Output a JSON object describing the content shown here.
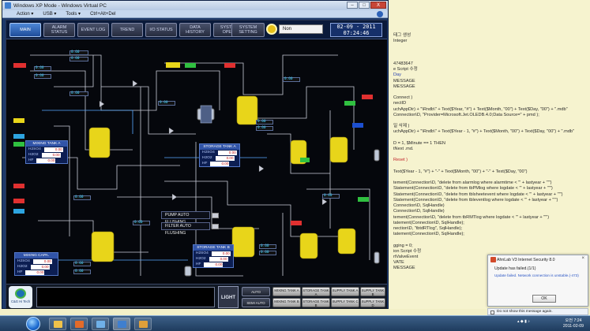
{
  "vm_window": {
    "title": "Windows XP Mode - Windows Virtual PC",
    "menu": [
      "Action ▾",
      "USB ▾",
      "Tools ▾",
      "Ctrl+Alt+Del"
    ],
    "controls": [
      "–",
      "□",
      "X"
    ]
  },
  "hmi": {
    "nav": [
      "MAIN",
      "ALARM STATUS",
      "EVENT LOG",
      "TREND",
      "I/O STATUS",
      "DATA HISTORY",
      "SYSTEM OPER.",
      "SYSTEM SETTING"
    ],
    "active_nav": "MAIN",
    "status_text": "Non",
    "date": "02-09 - 2011",
    "time": "07:24:46",
    "tank_labels": {
      "mixing_a": "MIXING TANK A",
      "mixing_capa": "MIXING CAPA.",
      "storage_a": "STORAGE TANK A",
      "storage_b": "STORAGE TANK B"
    },
    "tank_rows": {
      "mixing_a": [
        {
          "k": "H2SO4",
          "v": "0.00"
        },
        {
          "k": "H2O2",
          "v": "0.00"
        },
        {
          "k": "HF",
          "v": "0.00"
        }
      ],
      "mixing_capa": [
        {
          "k": "H2SO4",
          "v": "0.00"
        },
        {
          "k": "H2O2",
          "v": "0.00"
        },
        {
          "k": "HF",
          "v": "0.00"
        }
      ],
      "storage_a": [
        {
          "k": "H2SO4",
          "v": "0.00"
        },
        {
          "k": "H2O2",
          "v": "0.00"
        },
        {
          "k": "HF",
          "v": "0.00"
        }
      ],
      "storage_b": [
        {
          "k": "H2SO4",
          "v": "0.00"
        },
        {
          "k": "H2O2",
          "v": "0.00"
        },
        {
          "k": "HF",
          "v": "0.00"
        }
      ]
    },
    "flush": [
      "PUMP AUTO FLUSHING",
      "FILTER AUTO FLUSHING"
    ],
    "bottom": {
      "light": "LIGHT",
      "auto": "AUTO",
      "semi_auto": "SEMI AUTO",
      "tank_buttons_top": [
        "MIXING TANK A",
        "STORAGE TANK A",
        "SUPPLY TANK A",
        "SUPPLY TANK B"
      ],
      "tank_buttons_bottom": [
        "MIXING TANK B",
        "STORAGE TANK B",
        "SUPPLY TANK C",
        "SUPPLY TANK D"
      ],
      "logo_text": "C&G Hi Tech"
    },
    "flow_tags": [
      "0.00",
      "0.00",
      "0.00",
      "0.00",
      "0.00",
      "0.00",
      "0.00",
      "0.00",
      "0.00",
      "0.00",
      "0.00",
      "0.00",
      "0.00",
      "0.00",
      "0.00",
      "0.00"
    ]
  },
  "code_pane": {
    "lines": [
      {
        "t": "태그 생성",
        "c": ""
      },
      {
        "t": "Integer",
        "c": ""
      },
      {
        "t": "",
        "c": ""
      },
      {
        "t": "",
        "c": ""
      },
      {
        "t": "",
        "c": ""
      },
      {
        "t": "47483647",
        "c": ""
      },
      {
        "t": "e Script 수정",
        "c": ""
      },
      {
        "t": "Day",
        "c": "b"
      },
      {
        "t": "MESSAGE",
        "c": ""
      },
      {
        "t": "MESSAGE",
        "c": ""
      },
      {
        "t": "",
        "c": ""
      },
      {
        "t": "Connect )",
        "c": ""
      },
      {
        "t": "nectID",
        "c": ""
      },
      {
        "t": "uchAppDir) + \"\\Rndb\\\" + Text($Year, \"#\") + Text($Month, \"00\") + Text($Day, \"00\") + \".mdb\"",
        "c": ""
      },
      {
        "t": "Connection\\D, \"Provider=Microsoft.Jet.OLEDB.4.0;Data Source=\" + pmd );",
        "c": ""
      },
      {
        "t": "",
        "c": ""
      },
      {
        "t": "일 삭제 )",
        "c": ""
      },
      {
        "t": "uchAppDir) + \"\\Rndb\\\" + Text($Year - 1, \"#\") + Text($Month, \"00\") + Text($Day, \"00\") + \".mdb\"",
        "c": ""
      },
      {
        "t": "",
        "c": ""
      },
      {
        "t": "D = 1, $Minute == 1 THEN",
        "c": ""
      },
      {
        "t": "tNext .md.",
        "c": ""
      },
      {
        "t": "",
        "c": ""
      },
      {
        "t": "Reset )",
        "c": "r"
      },
      {
        "t": "",
        "c": ""
      },
      {
        "t": "Text($Year - 1, \"#\") + \"-\" + Text($Month, \"00\") + \"-\" + Text($Day, \"00\")",
        "c": ""
      },
      {
        "t": "",
        "c": ""
      },
      {
        "t": "tement(Connection\\D, \"delete from alarmlog where alarmtime < '\" + lastyear + \"'\")",
        "c": ""
      },
      {
        "t": "Statement(Connection\\D, \"delete from tbPMlog where logdate < '\" + lastyear + \"'\")",
        "c": ""
      },
      {
        "t": "Statement(Connection\\D, \"delete from tblsheetevent where logdate < '\" + lastyear + \"'\")",
        "c": ""
      },
      {
        "t": "Statement(Connection\\D, \"delete from tbleventlog where logdate < '\" + lastyear + \"'\")",
        "c": ""
      },
      {
        "t": "Connection\\D, SqlHandle)",
        "c": ""
      },
      {
        "t": "Connection\\D, SqlHandle)",
        "c": ""
      },
      {
        "t": "tement(Connection\\D, \"delete from tbRMTlog where logdate < '\" + lastyear + \"'\")",
        "c": ""
      },
      {
        "t": "tatement(Connection\\D, SqlHandle);",
        "c": ""
      },
      {
        "t": "nection\\D, \"tbtdRTlog\", SqlHandle);",
        "c": ""
      },
      {
        "t": "tatement(Connection\\D, SqlHandle);",
        "c": ""
      },
      {
        "t": "",
        "c": ""
      },
      {
        "t": "gging = 0;",
        "c": ""
      },
      {
        "t": "ion Script 수정",
        "c": ""
      },
      {
        "t": "rtValveEvent",
        "c": ""
      },
      {
        "t": "VATE",
        "c": ""
      },
      {
        "t": "MESSAGE",
        "c": ""
      }
    ]
  },
  "popup": {
    "title": "AhnLab V3 Internet Security 8.0",
    "line1": "Update has failed.(1/1)",
    "line2": "Update failed. Network connection is unstable.(-473)",
    "ok": "OK",
    "checkbox": "Do not show this message again."
  },
  "taskbar": {
    "time": "오전 7:24",
    "date": "2011-02-09"
  },
  "colors": {
    "hmi_bg": "#05070c",
    "tank_yellow": "#e8d51a",
    "accent_blue": "#1f4d9a",
    "value_red": "#c01515"
  }
}
